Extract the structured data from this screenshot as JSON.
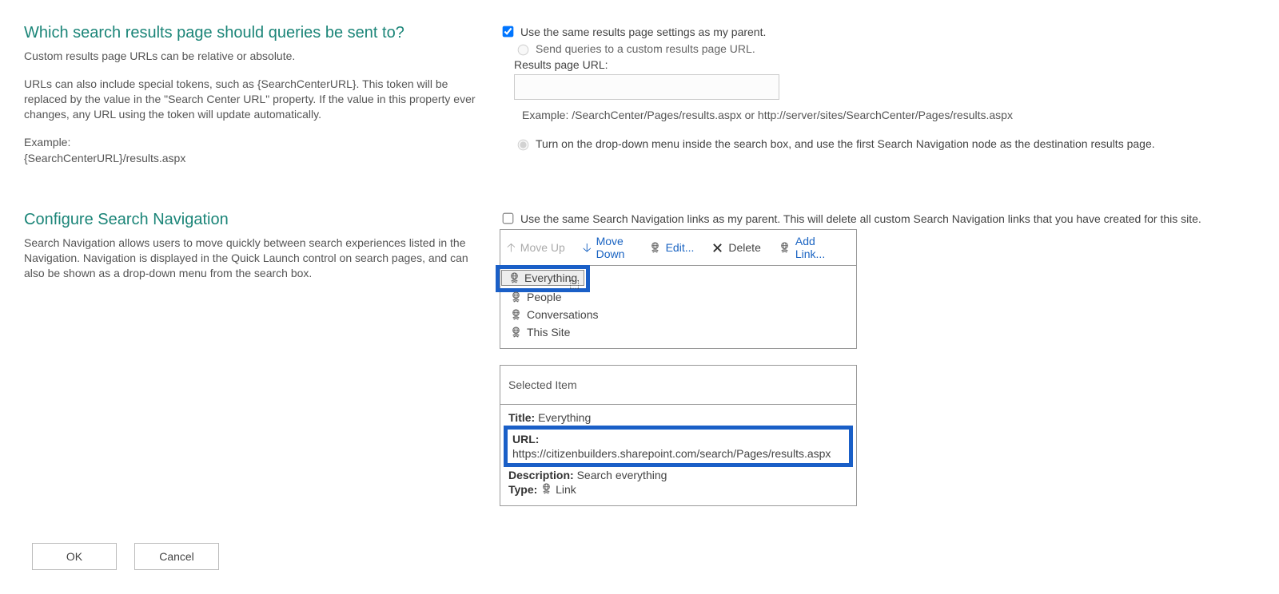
{
  "section1": {
    "heading": "Which search results page should queries be sent to?",
    "para1": "Custom results page URLs can be relative or absolute.",
    "para2": "URLs can also include special tokens, such as {SearchCenterURL}. This token will be replaced by the value in the \"Search Center URL\" property. If the value in this property ever changes, any URL using the token will update automatically.",
    "para3a": "Example:",
    "para3b": "{SearchCenterURL}/results.aspx",
    "opt_parent": "Use the same results page settings as my parent.",
    "opt_custom": "Send queries to a custom results page URL.",
    "url_label": "Results page URL:",
    "url_example": "Example: /SearchCenter/Pages/results.aspx or http://server/sites/SearchCenter/Pages/results.aspx",
    "opt_dropdown": "Turn on the drop-down menu inside the search box, and use the first Search Navigation node as the destination results page."
  },
  "section2": {
    "heading": "Configure Search Navigation",
    "para": "Search Navigation allows users to move quickly between search experiences listed in the Navigation. Navigation is displayed in the Quick Launch control on search pages, and can also be shown as a drop-down menu from the search box.",
    "opt_inherit": "Use the same Search Navigation links as my parent. This will delete all custom Search Navigation links that you have created for this site."
  },
  "toolbar": {
    "move_up": "Move Up",
    "move_down": "Move Down",
    "edit": "Edit...",
    "del": "Delete",
    "add": "Add Link..."
  },
  "nav_items": {
    "0": "Everything",
    "1": "People",
    "2": "Conversations",
    "3": "This Site"
  },
  "selected": {
    "header": "Selected Item",
    "title_label": "Title:",
    "title_value": "Everything",
    "url_label": "URL:",
    "url_value": "https://citizenbuilders.sharepoint.com/search/Pages/results.aspx",
    "desc_label": "Description:",
    "desc_value": "Search everything",
    "type_label": "Type:",
    "type_value": "Link"
  },
  "buttons": {
    "ok": "OK",
    "cancel": "Cancel"
  }
}
